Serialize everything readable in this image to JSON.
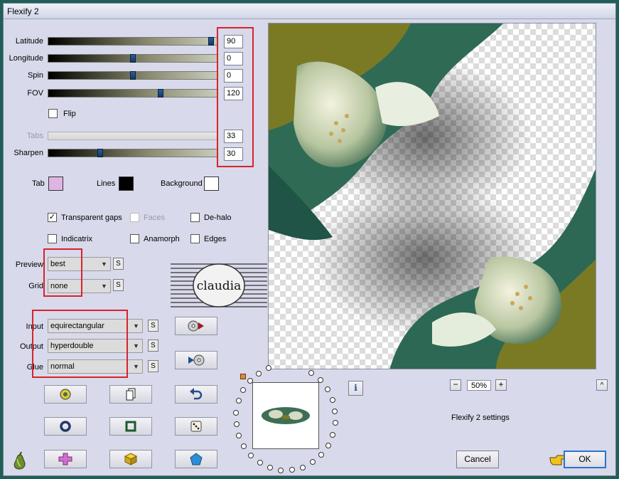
{
  "window": {
    "title": "Flexify 2"
  },
  "sliders": [
    {
      "label": "Latitude",
      "value": "90",
      "enabled": true,
      "fraction": 0.98
    },
    {
      "label": "Longitude",
      "value": "0",
      "enabled": true,
      "fraction": 0.5
    },
    {
      "label": "Spin",
      "value": "0",
      "enabled": true,
      "fraction": 0.5
    },
    {
      "label": "FOV",
      "value": "120",
      "enabled": true,
      "fraction": 0.67
    },
    {
      "label": "Tabs",
      "value": "33",
      "enabled": false,
      "fraction": 0.33
    },
    {
      "label": "Sharpen",
      "value": "30",
      "enabled": true,
      "fraction": 0.3
    }
  ],
  "flip": {
    "label": "Flip",
    "checked": false
  },
  "colors": {
    "tab": {
      "label": "Tab",
      "color": "#dfb4e2"
    },
    "lines": {
      "label": "Lines",
      "color": "#000000"
    },
    "background": {
      "label": "Background",
      "color": "#ffffff"
    }
  },
  "options": {
    "transparent_gaps": {
      "label": "Transparent gaps",
      "checked": true
    },
    "faces": {
      "label": "Faces",
      "checked": false
    },
    "de_halo": {
      "label": "De-halo",
      "checked": false
    },
    "indicatrix": {
      "label": "Indicatrix",
      "checked": false
    },
    "anamorph": {
      "label": "Anamorph",
      "checked": false
    },
    "edges": {
      "label": "Edges",
      "checked": false
    }
  },
  "preview_settings": {
    "preview": {
      "label": "Preview",
      "value": "best"
    },
    "grid": {
      "label": "Grid",
      "value": "none"
    }
  },
  "mapping": {
    "input": {
      "label": "Input",
      "value": "equirectangular"
    },
    "output": {
      "label": "Output",
      "value": "hyperdouble"
    },
    "glue": {
      "label": "Glue",
      "value": "normal"
    }
  },
  "small_button_label": "S",
  "watermark": {
    "text": "claudia"
  },
  "zoom": {
    "minus": "−",
    "value": "50%",
    "plus": "+"
  },
  "info_label": "i",
  "scroll_up": "^",
  "settings_name": "Flexify 2 settings",
  "buttons": {
    "cancel": "Cancel",
    "ok": "OK"
  },
  "accent_red": "#d9232b"
}
